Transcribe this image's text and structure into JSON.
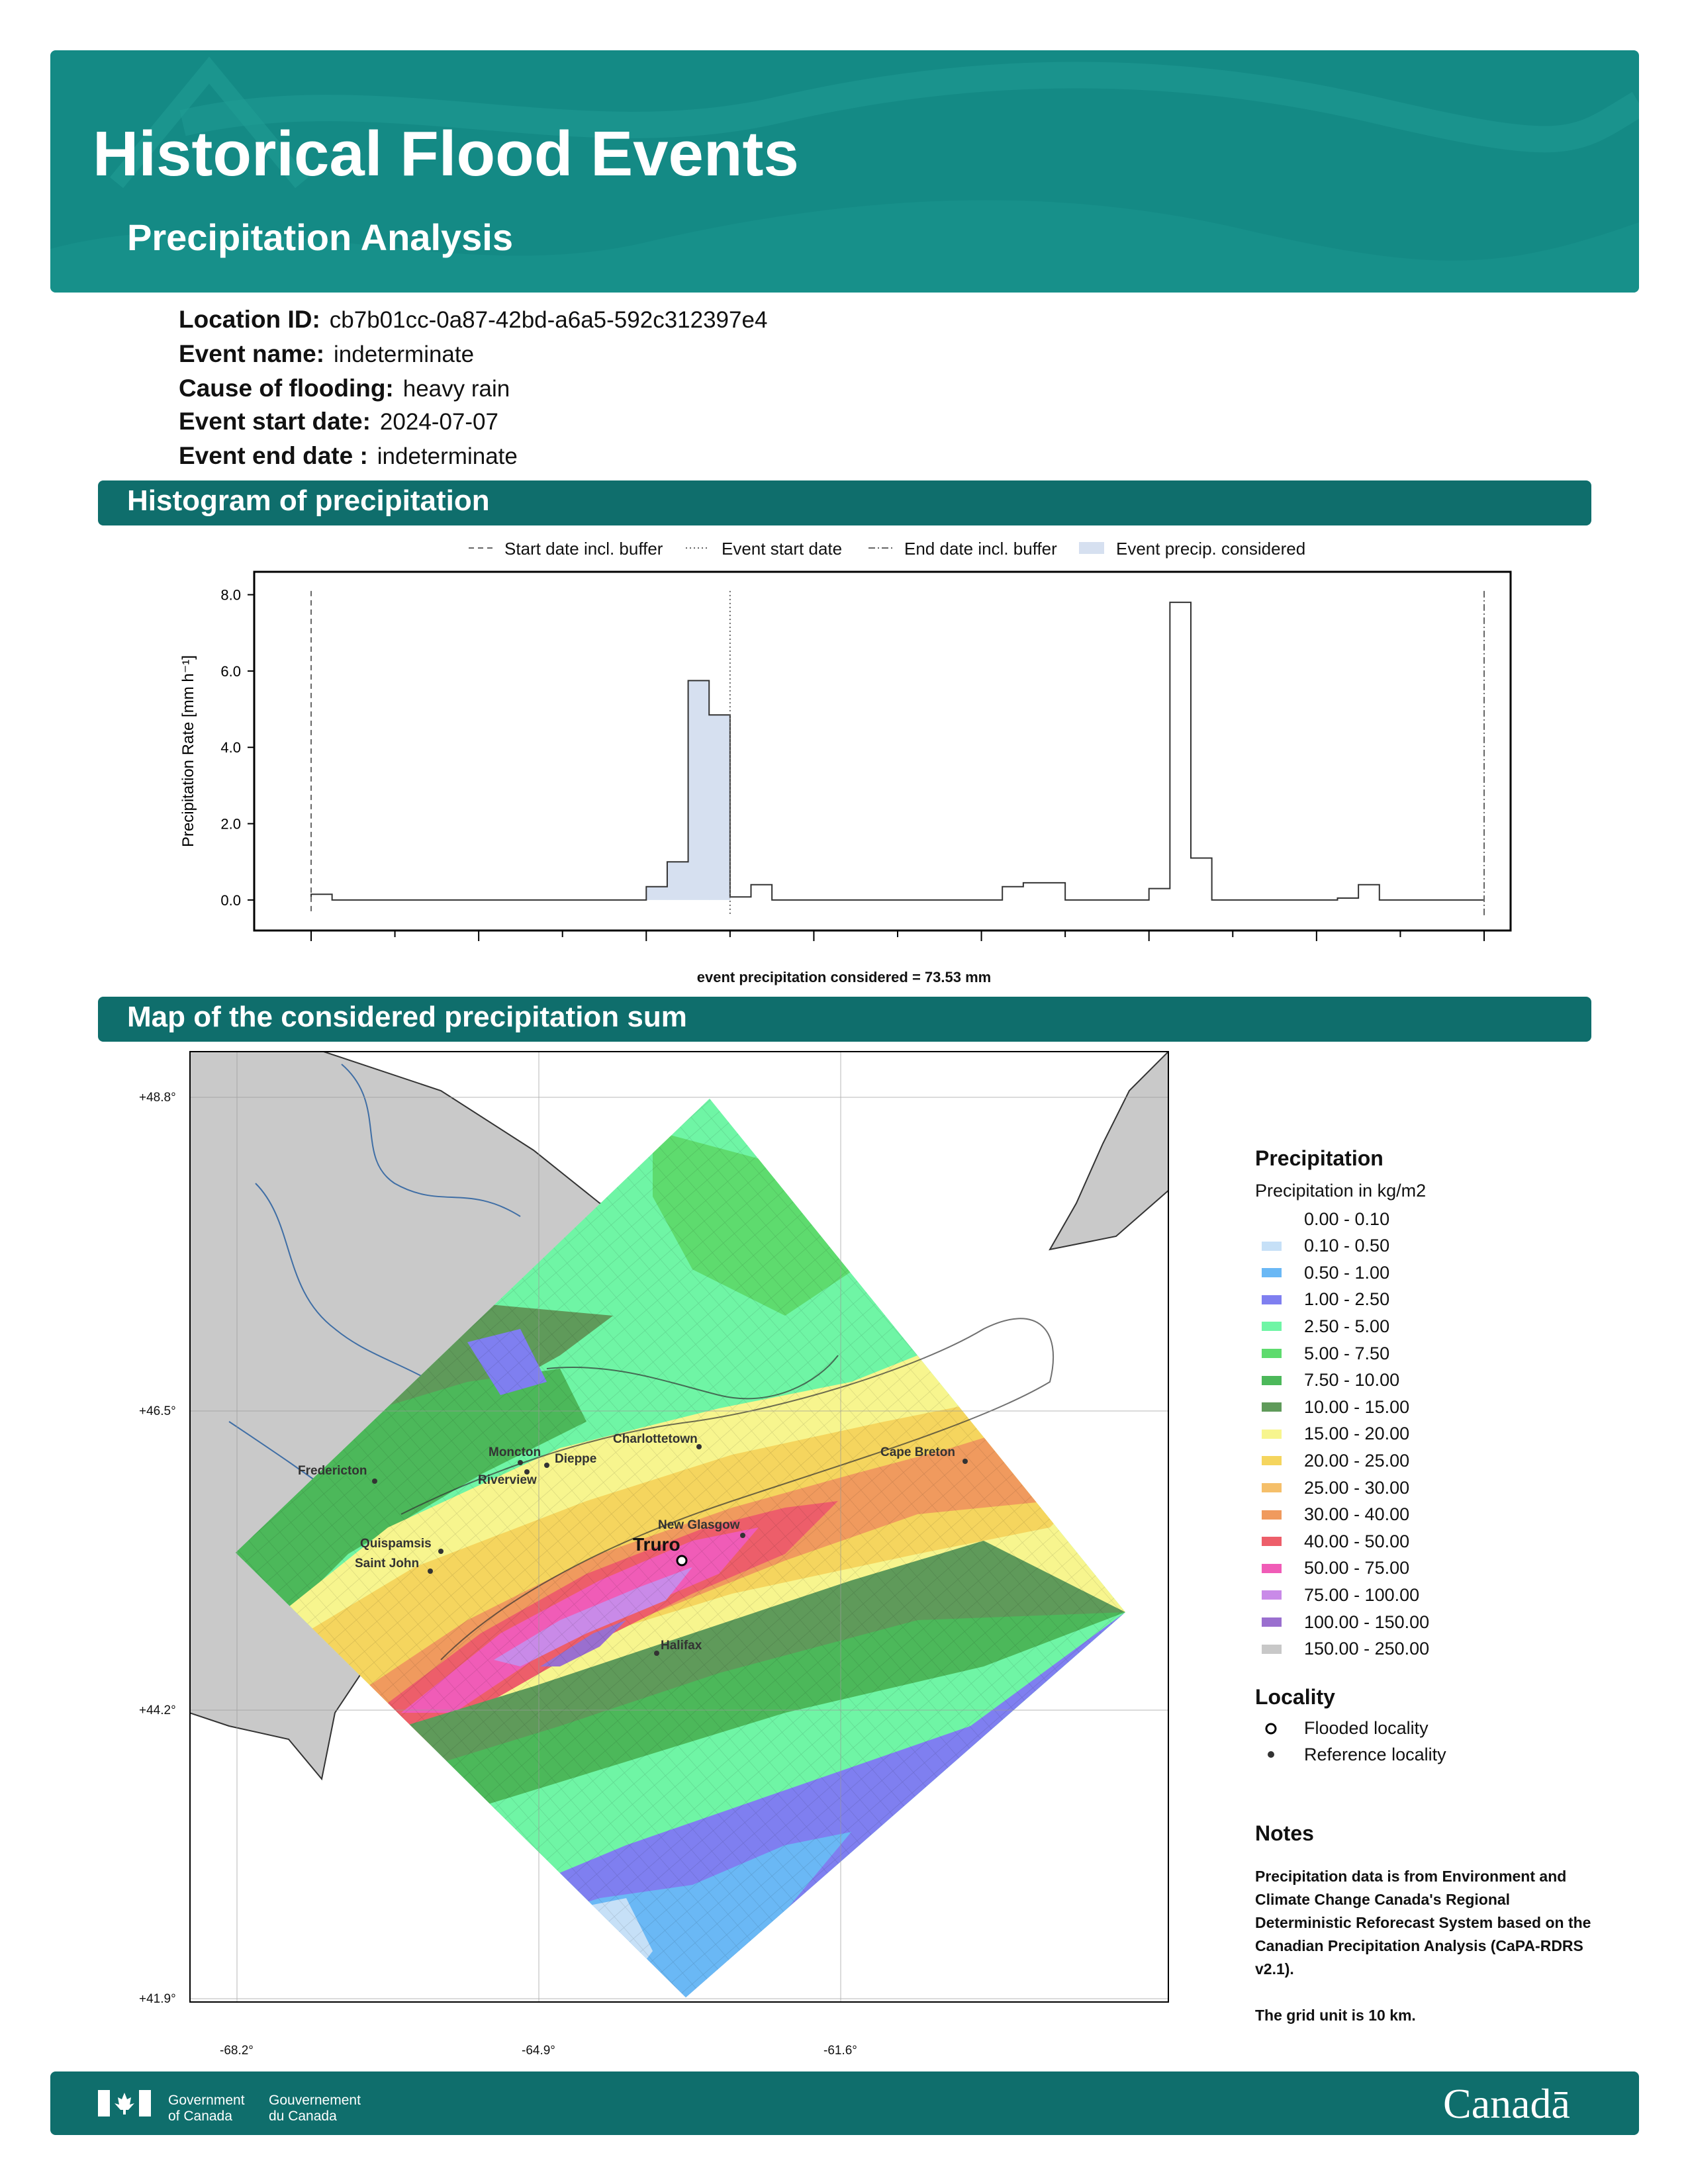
{
  "header": {
    "title": "Historical Flood Events",
    "subtitle": "Precipitation Analysis",
    "colors": {
      "banner": "#148a85",
      "section_bar": "#0f6e6c"
    }
  },
  "info": [
    {
      "label": "Location ID:",
      "value": "cb7b01cc-0a87-42bd-a6a5-592c312397e4"
    },
    {
      "label": "Event name:",
      "value": "indeterminate"
    },
    {
      "label": "Cause of flooding:",
      "value": "heavy rain"
    },
    {
      "label": "Event start date:",
      "value": "2024-07-07"
    },
    {
      "label": "Event end date :",
      "value": "indeterminate"
    }
  ],
  "sections": {
    "histogram": "Histogram of precipitation",
    "map": "Map of the considered precipitation sum"
  },
  "chart_data": {
    "type": "bar",
    "ylabel": "Precipitation Rate [mm h⁻¹]",
    "ylim": [
      -0.8,
      8.6
    ],
    "yticks": [
      "0.0",
      "2.0",
      "4.0",
      "6.0",
      "8.0"
    ],
    "bins": 56,
    "values": [
      0.15,
      0,
      0,
      0,
      0,
      0,
      0,
      0,
      0,
      0,
      0,
      0,
      0,
      0,
      0,
      0,
      0.35,
      1.0,
      5.75,
      4.85,
      0.08,
      0.4,
      0,
      0,
      0,
      0,
      0,
      0,
      0,
      0,
      0,
      0,
      0,
      0.35,
      0.45,
      0.45,
      0,
      0,
      0,
      0,
      0.3,
      7.8,
      1.1,
      0,
      0,
      0,
      0,
      0,
      0,
      0.05,
      0.4,
      0,
      0,
      0,
      0,
      0
    ],
    "event_precip_bins": [
      16,
      19
    ],
    "markers": [
      {
        "name": "Start date incl. buffer",
        "bin": 0,
        "style": "dashed"
      },
      {
        "name": "Event start date",
        "bin": 20,
        "style": "dotted"
      },
      {
        "name": "End date incl. buffer",
        "bin": 56,
        "style": "dashdot"
      }
    ],
    "legend": [
      "Start date incl. buffer",
      "Event start date",
      "End date incl. buffer",
      "Event precip. considered"
    ],
    "fill_color": "#d6e0f0",
    "caption": "event precipitation considered = 73.53 mm",
    "legend_placement": "top"
  },
  "map": {
    "lat_labels": [
      "+48.8°",
      "+46.5°",
      "+44.2°",
      "+41.9°"
    ],
    "lon_labels": [
      "-68.2°",
      "-64.9°",
      "-61.6°"
    ],
    "cities": [
      {
        "name": "Fredericton"
      },
      {
        "name": "Moncton"
      },
      {
        "name": "Dieppe"
      },
      {
        "name": "Riverview"
      },
      {
        "name": "Charlottetown"
      },
      {
        "name": "Cape Breton"
      },
      {
        "name": "New Glasgow"
      },
      {
        "name": "Truro",
        "flooded": true
      },
      {
        "name": "Quispamsis"
      },
      {
        "name": "Saint John"
      },
      {
        "name": "Halifax"
      }
    ]
  },
  "legend": {
    "title": "Precipitation",
    "subtitle": "Precipitation in kg/m2",
    "classes": [
      {
        "label": "0.00 - 0.10",
        "color": "#ffffff"
      },
      {
        "label": "0.10 - 0.50",
        "color": "#c6e0f7"
      },
      {
        "label": "0.50 - 1.00",
        "color": "#6ab8f5"
      },
      {
        "label": "1.00 - 2.50",
        "color": "#7f7ff0"
      },
      {
        "label": "2.50 - 5.00",
        "color": "#6ff5a5"
      },
      {
        "label": "5.00 - 7.50",
        "color": "#5edb6e"
      },
      {
        "label": "7.50 - 10.00",
        "color": "#4cb85a"
      },
      {
        "label": "10.00 - 15.00",
        "color": "#5f9a5a"
      },
      {
        "label": "15.00 - 20.00",
        "color": "#f7f58e"
      },
      {
        "label": "20.00 - 25.00",
        "color": "#f5d55e"
      },
      {
        "label": "25.00 - 30.00",
        "color": "#f5bf6a"
      },
      {
        "label": "30.00 - 40.00",
        "color": "#f09a5e"
      },
      {
        "label": "40.00 - 50.00",
        "color": "#ed5e6a"
      },
      {
        "label": "50.00 - 75.00",
        "color": "#f05cb7"
      },
      {
        "label": "75.00 - 100.00",
        "color": "#c98ae8"
      },
      {
        "label": "100.00 - 150.00",
        "color": "#9a6fcf"
      },
      {
        "label": "150.00 - 250.00",
        "color": "#c8c8c8"
      }
    ],
    "locality_title": "Locality",
    "locality": [
      "Flooded locality",
      "Reference locality"
    ]
  },
  "notes": {
    "title": "Notes",
    "text1": "Precipitation data is from Environment and Climate Change Canada's Regional Deterministic Reforecast System based on the Canadian Precipitation Analysis (CaPA-RDRS v2.1).",
    "text2": "The grid unit is 10 km."
  },
  "footer": {
    "gov_en": [
      "Government",
      "of Canada"
    ],
    "gov_fr": [
      "Gouvernement",
      "du Canada"
    ],
    "wordmark": "Canadā"
  }
}
